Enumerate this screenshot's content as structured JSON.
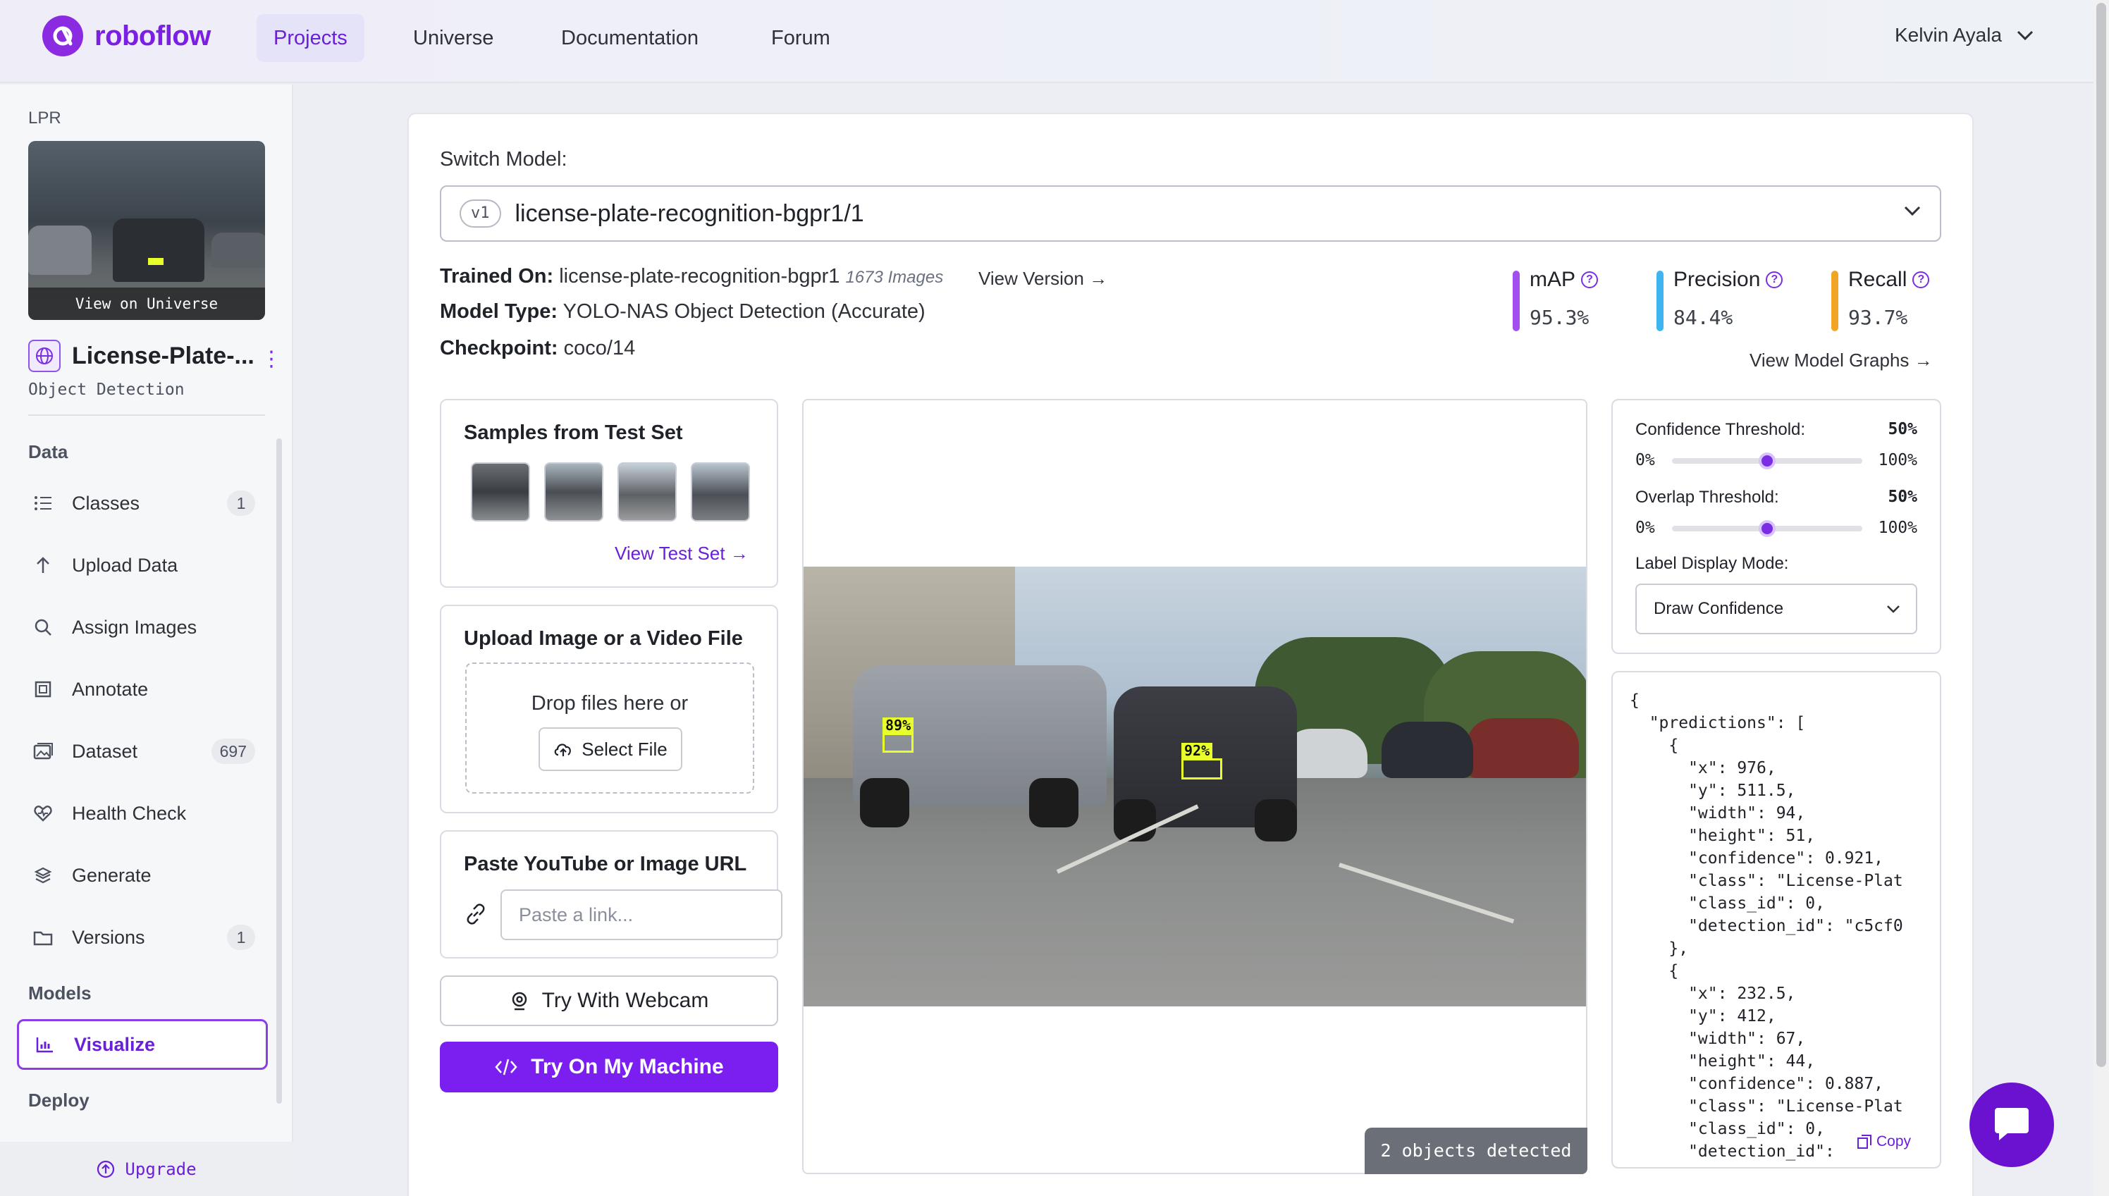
{
  "nav": {
    "brand": "roboflow",
    "items": [
      "Projects",
      "Universe",
      "Documentation",
      "Forum"
    ],
    "active": "Projects",
    "user": "Kelvin Ayala"
  },
  "sidebar": {
    "project_tag": "LPR",
    "thumb_caption": "View on Universe",
    "project_name": "License-Plate-...",
    "project_type": "Object Detection",
    "sections": {
      "data": "Data",
      "models": "Models",
      "deploy": "Deploy"
    },
    "items": [
      {
        "label": "Classes",
        "badge": "1",
        "icon": "list-icon"
      },
      {
        "label": "Upload Data",
        "badge": "",
        "icon": "upload-arrow-icon"
      },
      {
        "label": "Assign Images",
        "badge": "",
        "icon": "search-icon"
      },
      {
        "label": "Annotate",
        "badge": "",
        "icon": "annotate-icon"
      },
      {
        "label": "Dataset",
        "badge": "697",
        "icon": "images-icon"
      },
      {
        "label": "Health Check",
        "badge": "",
        "icon": "health-heart-icon"
      },
      {
        "label": "Generate",
        "badge": "",
        "icon": "generate-layers-icon"
      },
      {
        "label": "Versions",
        "badge": "1",
        "icon": "folder-icon"
      }
    ],
    "visualize": "Visualize",
    "upgrade": "Upgrade"
  },
  "model": {
    "switch_label": "Switch Model:",
    "version_pill": "v1",
    "selected": "license-plate-recognition-bgpr1/1",
    "trained_on_label": "Trained On:",
    "trained_on": "license-plate-recognition-bgpr1",
    "image_count": "1673 Images",
    "view_version": "View Version",
    "model_type_label": "Model Type:",
    "model_type": "YOLO-NAS Object Detection (Accurate)",
    "checkpoint_label": "Checkpoint:",
    "checkpoint": "coco/14",
    "view_graphs": "View Model Graphs"
  },
  "metrics": [
    {
      "name": "mAP",
      "value": "95.3%",
      "color": "#a34ff0"
    },
    {
      "name": "Precision",
      "value": "84.4%",
      "color": "#3fb5f0"
    },
    {
      "name": "Recall",
      "value": "93.7%",
      "color": "#f0a526"
    }
  ],
  "samples": {
    "title": "Samples from Test Set",
    "link": "View Test Set"
  },
  "upload": {
    "title": "Upload Image or a Video File",
    "drop_text": "Drop files here or",
    "select_file": "Select File"
  },
  "paste": {
    "title": "Paste YouTube or Image URL",
    "placeholder": "Paste a link..."
  },
  "buttons": {
    "webcam": "Try With Webcam",
    "machine": "Try On My Machine"
  },
  "preview": {
    "detections": [
      {
        "label": "89%"
      },
      {
        "label": "92%"
      }
    ],
    "objects_detected": "2 objects detected"
  },
  "settings": {
    "confidence_label": "Confidence Threshold:",
    "confidence_value": "50%",
    "overlap_label": "Overlap Threshold:",
    "overlap_value": "50%",
    "min": "0%",
    "max": "100%",
    "confidence_level": 0.5,
    "overlap_level": 0.5,
    "label_mode_label": "Label Display Mode:",
    "label_mode": "Draw Confidence"
  },
  "json_output": "{\n  \"predictions\": [\n    {\n      \"x\": 976,\n      \"y\": 511.5,\n      \"width\": 94,\n      \"height\": 51,\n      \"confidence\": 0.921,\n      \"class\": \"License-Plat\n      \"class_id\": 0,\n      \"detection_id\": \"c5cf0\n    },\n    {\n      \"x\": 232.5,\n      \"y\": 412,\n      \"width\": 67,\n      \"height\": 44,\n      \"confidence\": 0.887,\n      \"class\": \"License-Plat\n      \"class_id\": 0,\n      \"detection_id\":",
  "copy": "Copy",
  "colors": {
    "brand": "#7b1fe4",
    "primary_button": "#7a1ff0",
    "detection_box": "#e8ff2b"
  }
}
